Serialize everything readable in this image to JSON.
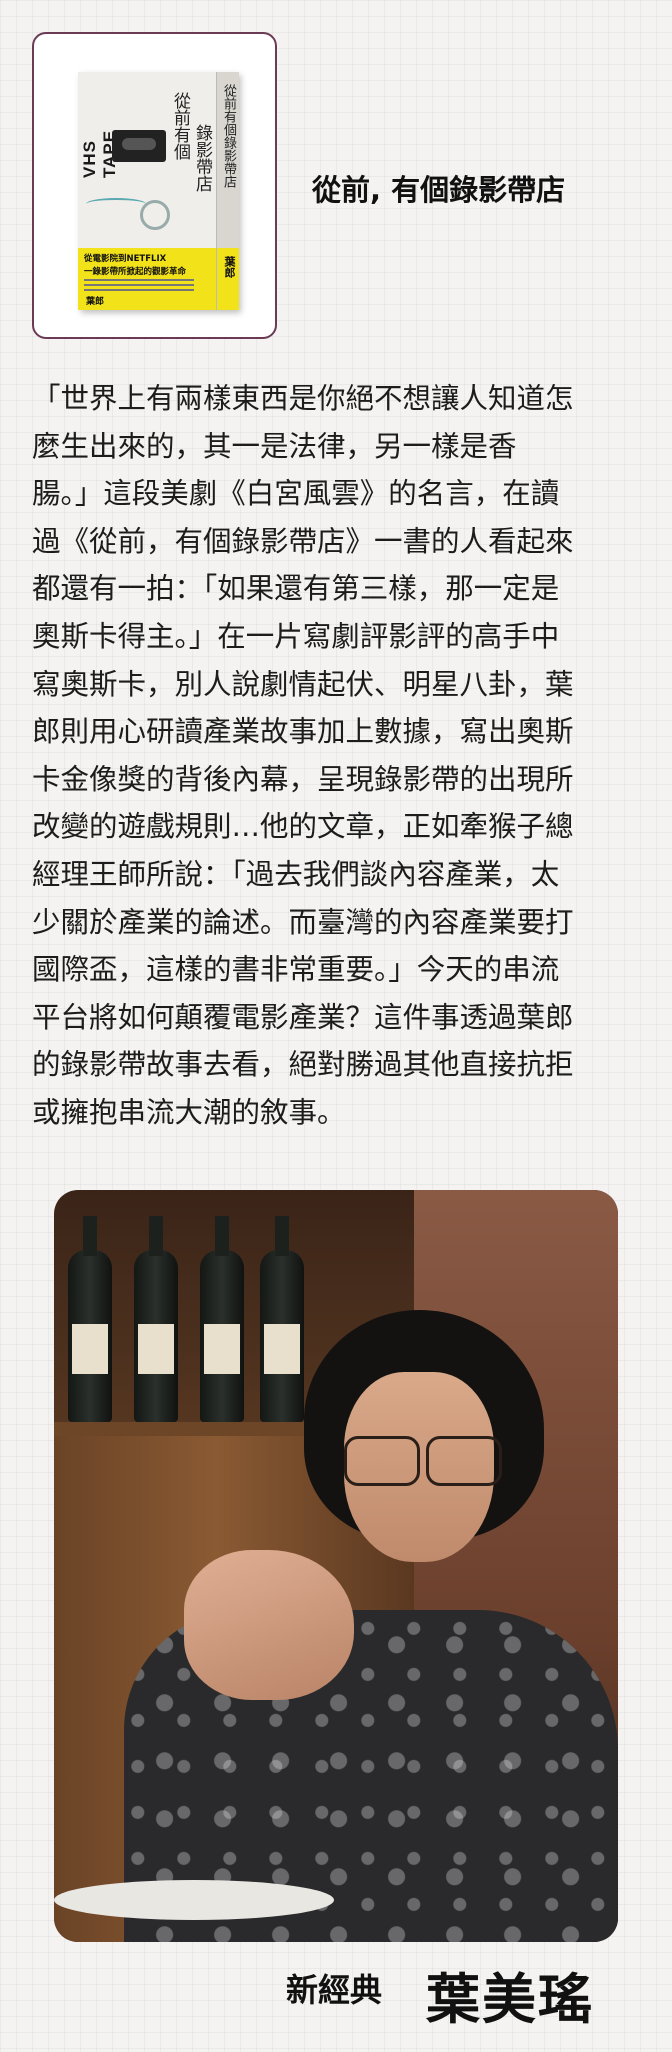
{
  "book": {
    "title": "從前, 有個錄影帶店",
    "cover": {
      "tape_label": "VHS TAPE",
      "title_part1": "從前有個",
      "title_part2": "錄影帶店",
      "tagline1": "從電影院到NETFLIX",
      "tagline2": "一錄影帶所掀起的觀影革命",
      "author": "葉郎",
      "spine_title": "從前有個錄影帶店",
      "spine_author": "葉郎"
    }
  },
  "article": {
    "lines": [
      "「世界上有兩樣東西是你絕不想讓人知道怎",
      "麼生出來的，其一是法律，另一樣是香",
      "腸。」這段美劇《白宮風雲》的名言，在讀",
      "過《從前，有個錄影帶店》一書的人看起來",
      "都還有一拍：「如果還有第三樣，那一定是",
      "奧斯卡得主。」在一片寫劇評影評的高手中",
      "寫奧斯卡，別人說劇情起伏、明星八卦，葉",
      "郎則用心研讀產業故事加上數據，寫出奧斯",
      "卡金像獎的背後內幕，呈現錄影帶的出現所",
      "改變的遊戲規則…他的文章，正如牽猴子總",
      "經理王師所說：「過去我們談內容產業，太",
      "少關於產業的論述。而臺灣的內容產業要打",
      "國際盃，這樣的書非常重要。」今天的串流",
      "平台將如何顛覆電影產業？這件事透過葉郎",
      "的錄影帶故事去看，絕對勝過其他直接抗拒",
      "或擁抱串流大潮的敘事。"
    ]
  },
  "credit": {
    "publisher": "新經典",
    "name": "葉美瑤"
  },
  "colors": {
    "card_border": "#6b3a55",
    "cover_yellow": "#f2e21a",
    "background": "#f4f3f1"
  }
}
